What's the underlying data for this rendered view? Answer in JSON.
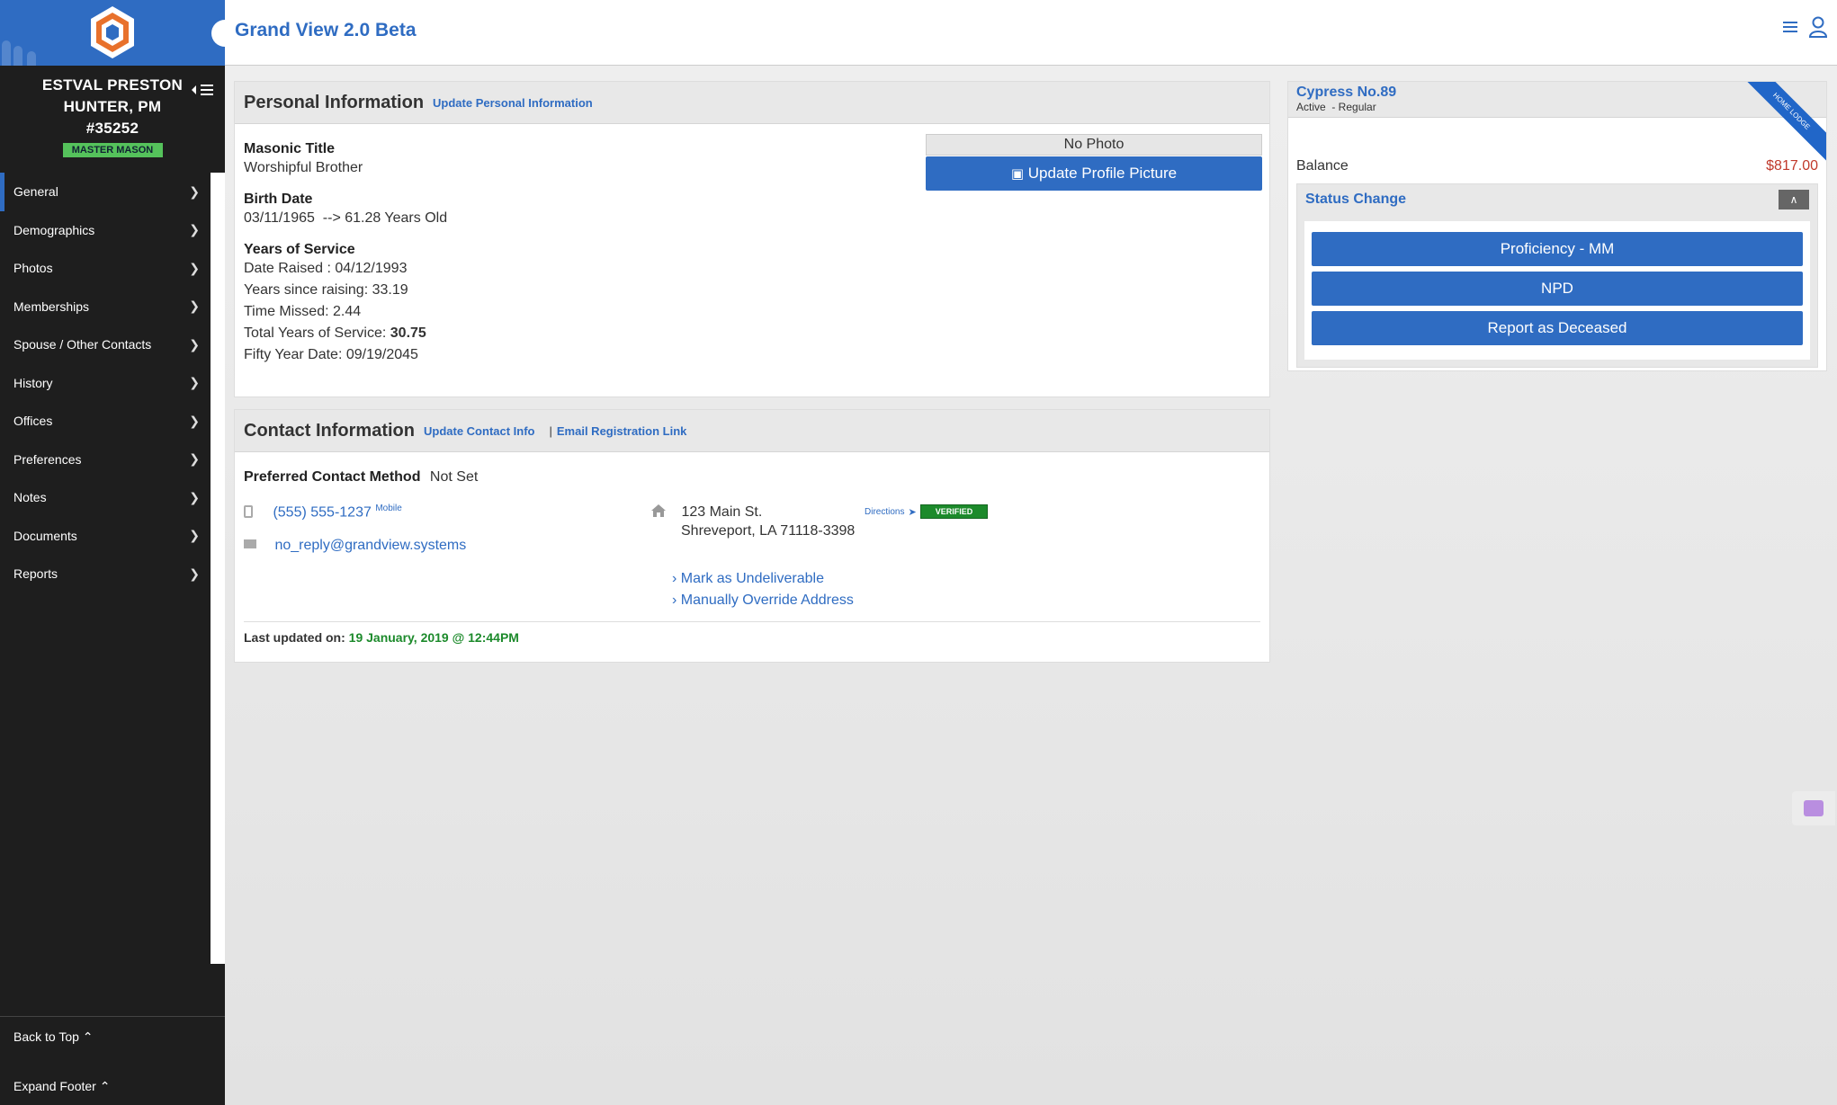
{
  "header": {
    "title": "Grand View 2.0 Beta"
  },
  "member": {
    "name_line1": "ESTVAL PRESTON",
    "name_line2": "HUNTER, PM",
    "number": "#35252",
    "degree_badge": "MASTER MASON"
  },
  "nav": {
    "items": [
      {
        "label": "General"
      },
      {
        "label": "Demographics"
      },
      {
        "label": "Photos"
      },
      {
        "label": "Memberships"
      },
      {
        "label": "Spouse / Other Contacts"
      },
      {
        "label": "History"
      },
      {
        "label": "Offices"
      },
      {
        "label": "Preferences"
      },
      {
        "label": "Notes"
      },
      {
        "label": "Documents"
      },
      {
        "label": "Reports"
      }
    ],
    "back_to_top": "Back to Top",
    "expand_footer": "Expand Footer"
  },
  "personal": {
    "title": "Personal Information",
    "update_link": "Update Personal Information",
    "masonic_title_label": "Masonic Title",
    "masonic_title": "Worshipful Brother",
    "birth_date_label": "Birth Date",
    "birth_date": "03/11/1965  --> 61.28 Years Old",
    "service_label": "Years of Service",
    "date_raised": "Date Raised : 04/12/1993",
    "years_since": "Years since raising: 33.19",
    "time_missed": "Time Missed: 2.44",
    "total_service_prefix": "Total Years of Service: ",
    "total_service_value": "30.75",
    "fifty_year": "Fifty Year Date: 09/19/2045",
    "no_photo": "No Photo",
    "update_photo": "Update Profile Picture"
  },
  "contact": {
    "title": "Contact Information",
    "update_link": "Update Contact Info",
    "separator": "|",
    "email_link": "Email Registration Link",
    "preferred_label": "Preferred Contact Method",
    "preferred_value": "Not Set",
    "phone": "(555) 555-1237",
    "phone_type": "Mobile",
    "email": "no_reply@grandview.systems",
    "address_line1": "123 Main St.",
    "address_line2": "Shreveport, LA 71118-3398",
    "directions": "Directions",
    "verified": "VERIFIED",
    "mark_undeliverable": "Mark as Undeliverable",
    "override_address": "Manually Override Address",
    "last_updated_label": "Last updated on:",
    "last_updated_value": "19 January, 2019 @ 12:44PM"
  },
  "lodge": {
    "name": "Cypress No.89",
    "status": "Active  - Regular",
    "ribbon": "HOME LODGE",
    "balance_label": "Balance",
    "balance_value": "$817.00",
    "status_change_title": "Status Change",
    "buttons": [
      "Proficiency - MM",
      "NPD",
      "Report as Deceased"
    ]
  },
  "colors": {
    "brand_blue": "#2f6cc2",
    "sidebar_bg": "#1e1e1e",
    "badge_green": "#55c25b",
    "verified_green": "#1c8a2b",
    "balance_red": "#c0392b"
  }
}
